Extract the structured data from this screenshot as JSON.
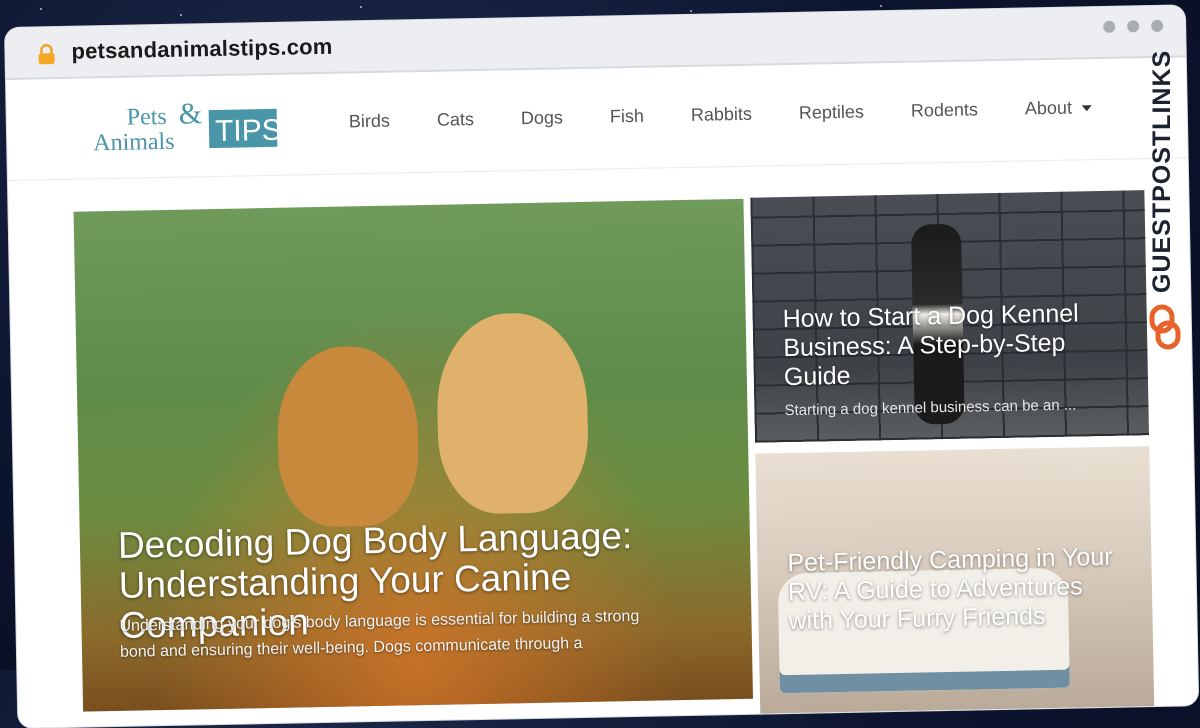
{
  "browser": {
    "url": "petsandanimalstips.com"
  },
  "site": {
    "logo": {
      "line1": "Pets",
      "amp": "&",
      "line2": "Animals",
      "tips": "TIPS"
    },
    "nav": [
      {
        "label": "Birds"
      },
      {
        "label": "Cats"
      },
      {
        "label": "Dogs"
      },
      {
        "label": "Fish"
      },
      {
        "label": "Rabbits"
      },
      {
        "label": "Reptiles"
      },
      {
        "label": "Rodents"
      },
      {
        "label": "About"
      }
    ]
  },
  "hero": {
    "title": "Decoding Dog Body Language: Understanding Your Canine Companion",
    "excerpt": "Understanding your dog's body language is essential for building a strong bond and ensuring their well-being. Dogs communicate through a"
  },
  "cards": [
    {
      "title": "How to Start a Dog Kennel Business: A Step-by-Step Guide",
      "excerpt": "Starting a dog kennel business can be an ..."
    },
    {
      "title": "Pet-Friendly Camping in Your RV: A Guide to Adventures with Your Furry Friends",
      "excerpt": ""
    }
  ],
  "watermark": {
    "text": "GUESTPOSTLINKS",
    "color": "#e8632b"
  },
  "icons": {
    "lock": "lock-icon",
    "about_caret": "chevron-down-icon"
  }
}
